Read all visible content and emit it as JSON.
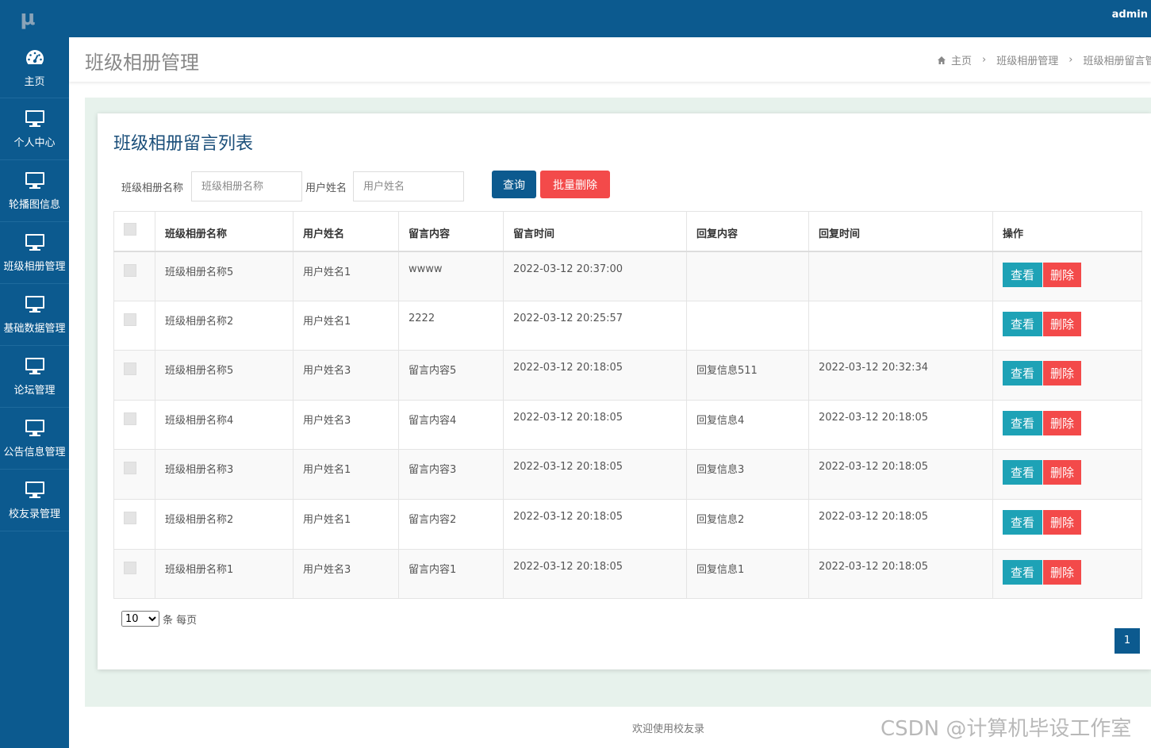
{
  "app": {
    "logo": "μ",
    "user": "admin"
  },
  "sidebar": {
    "items": [
      {
        "label": "主页",
        "icon": "dashboard-icon"
      },
      {
        "label": "个人中心",
        "icon": "monitor-icon"
      },
      {
        "label": "轮播图信息",
        "icon": "monitor-icon"
      },
      {
        "label": "班级相册管理",
        "icon": "monitor-icon"
      },
      {
        "label": "基础数据管理",
        "icon": "monitor-icon"
      },
      {
        "label": "论坛管理",
        "icon": "monitor-icon"
      },
      {
        "label": "公告信息管理",
        "icon": "monitor-icon"
      },
      {
        "label": "校友录管理",
        "icon": "monitor-icon"
      }
    ]
  },
  "header": {
    "title": "班级相册管理",
    "breadcrumb": [
      "主页",
      "班级相册管理",
      "班级相册留言管理"
    ]
  },
  "card": {
    "title": "班级相册留言列表"
  },
  "search": {
    "album_label": "班级相册名称",
    "album_placeholder": "班级相册名称",
    "user_label": "用户姓名",
    "user_placeholder": "用户姓名",
    "query_button": "查询",
    "batch_delete_button": "批量删除"
  },
  "table": {
    "columns": [
      "班级相册名称",
      "用户姓名",
      "留言内容",
      "留言时间",
      "回复内容",
      "回复时间",
      "操作"
    ],
    "view_label": "查看",
    "delete_label": "删除",
    "rows": [
      {
        "album": "班级相册名称5",
        "user": "用户姓名1",
        "content": "wwww",
        "time": "2022-03-12 20:37:00",
        "reply": "",
        "reply_time": ""
      },
      {
        "album": "班级相册名称2",
        "user": "用户姓名1",
        "content": "2222",
        "time": "2022-03-12 20:25:57",
        "reply": "",
        "reply_time": ""
      },
      {
        "album": "班级相册名称5",
        "user": "用户姓名3",
        "content": "留言内容5",
        "time": "2022-03-12 20:18:05",
        "reply": "回复信息511",
        "reply_time": "2022-03-12 20:32:34"
      },
      {
        "album": "班级相册名称4",
        "user": "用户姓名3",
        "content": "留言内容4",
        "time": "2022-03-12 20:18:05",
        "reply": "回复信息4",
        "reply_time": "2022-03-12 20:18:05"
      },
      {
        "album": "班级相册名称3",
        "user": "用户姓名1",
        "content": "留言内容3",
        "time": "2022-03-12 20:18:05",
        "reply": "回复信息3",
        "reply_time": "2022-03-12 20:18:05"
      },
      {
        "album": "班级相册名称2",
        "user": "用户姓名1",
        "content": "留言内容2",
        "time": "2022-03-12 20:18:05",
        "reply": "回复信息2",
        "reply_time": "2022-03-12 20:18:05"
      },
      {
        "album": "班级相册名称1",
        "user": "用户姓名3",
        "content": "留言内容1",
        "time": "2022-03-12 20:18:05",
        "reply": "回复信息1",
        "reply_time": "2022-03-12 20:18:05"
      }
    ]
  },
  "pagination": {
    "page_size": "10",
    "page_size_suffix": "条 每页",
    "current_page": "1"
  },
  "footer": {
    "text": "欢迎使用校友录"
  },
  "watermark": "CSDN @计算机毕设工作室",
  "colors": {
    "primary": "#0c5a8f",
    "danger": "#f34a4a",
    "info": "#1ea2b6",
    "main_bg": "#e7f2ec"
  }
}
